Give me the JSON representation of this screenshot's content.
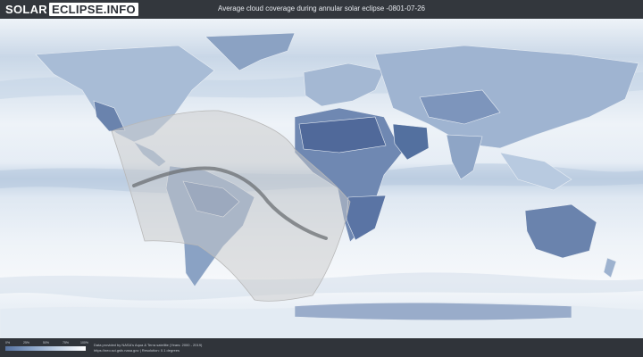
{
  "header": {
    "brand_part1": "SOLAR",
    "brand_part2": "ECLIPSE.INFO",
    "title": "Average cloud coverage during annular solar eclipse -0801-07-26"
  },
  "legend": {
    "ticks": [
      "0%",
      "25%",
      "50%",
      "75%",
      "100%"
    ],
    "colors": [
      "#5672a0",
      "#8aa4c8",
      "#c6d4e6",
      "#ffffff"
    ]
  },
  "credits": {
    "line1": "Data provided by NASA's Aqua & Terra satellite (Years: 2000 - 2019)",
    "line2": "https://neo.sci.gsfc.nasa.gov | Resolution: 0.1 degrees"
  },
  "map": {
    "colors": {
      "land_cloud_free": "#50699a",
      "cloud_light": "#b9cbe0",
      "cloud_white": "#f4f7fa",
      "ice": "#dfe8f1",
      "eclipse_band": "#c9c9c9",
      "central_line": "#6b6f73"
    }
  }
}
